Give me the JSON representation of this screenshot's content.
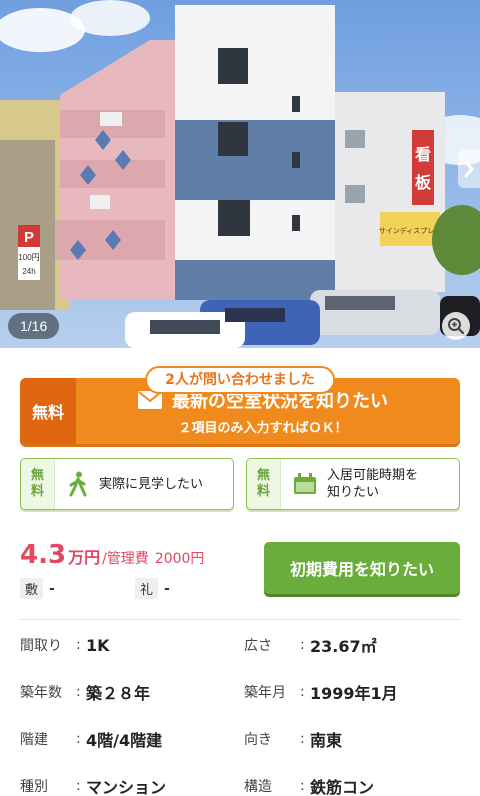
{
  "photo": {
    "counter": "1/16",
    "sign_text_1": "看",
    "sign_text_2": "板",
    "sign_text_3": "サインディスプレー",
    "parking_letter": "P",
    "parking_price": "100円",
    "parking_hours": "24h"
  },
  "inquiry_badge": "2人が問い合わせました",
  "vacancy_cta": {
    "free_label": "無料",
    "title": "最新の空室状況を知りたい",
    "subtitle": "２項目のみ入力すればＯＫ！"
  },
  "tour_cta": {
    "free_line1": "無",
    "free_line2": "料",
    "label": "実際に見学したい"
  },
  "movein_cta": {
    "free_line1": "無",
    "free_line2": "料",
    "label_line1": "入居可能時期を",
    "label_line2": "知りたい"
  },
  "price": {
    "rent": "4.3",
    "rent_unit": "万円",
    "separator": "/",
    "mgmt_label": "管理費",
    "mgmt_value": "2000円",
    "deposit_label": "敷",
    "deposit_value": "-",
    "key_money_label": "礼",
    "key_money_value": "-"
  },
  "initial_cost_button": "初期費用を知りたい",
  "specs": [
    {
      "key": "間取り",
      "value": "1K"
    },
    {
      "key": "広さ",
      "value": "23.67㎡"
    },
    {
      "key": "築年数",
      "value": "築２８年"
    },
    {
      "key": "築年月",
      "value": "1999年1月"
    },
    {
      "key": "階建",
      "value": "4階/4階建"
    },
    {
      "key": "向き",
      "value": "南東"
    },
    {
      "key": "種別",
      "value": "マンション"
    },
    {
      "key": "構造",
      "value": "鉄筋コン"
    }
  ],
  "colors": {
    "orange": "#f08a1d",
    "green": "#6aad3d",
    "price_red": "#e34762"
  }
}
